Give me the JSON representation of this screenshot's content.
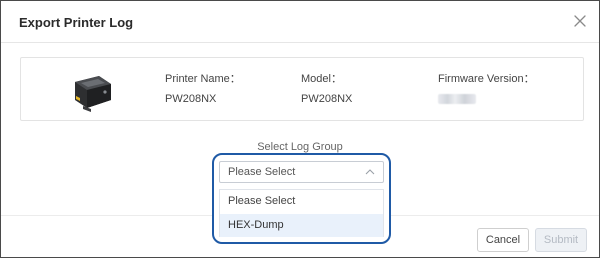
{
  "dialog": {
    "title": "Export Printer Log",
    "close_icon": "close-icon"
  },
  "printer_info": {
    "image_icon": "printer-icon",
    "name_label": "Printer Name：",
    "name_value": "PW208NX",
    "model_label": "Model：",
    "model_value": "PW208NX",
    "firmware_label": "Firmware Version："
  },
  "log_group": {
    "label": "Select Log Group",
    "selected": "Please Select",
    "chevron_icon": "chevron-up-icon",
    "options": [
      "Please Select",
      "HEX-Dump"
    ],
    "highlighted_option": "HEX-Dump"
  },
  "footer": {
    "cancel_label": "Cancel",
    "submit_label": "Submit"
  },
  "colors": {
    "highlight_border": "#1f5aa6",
    "option_hover": "#e9f1fb",
    "submit_disabled_text": "#b4bac3"
  }
}
